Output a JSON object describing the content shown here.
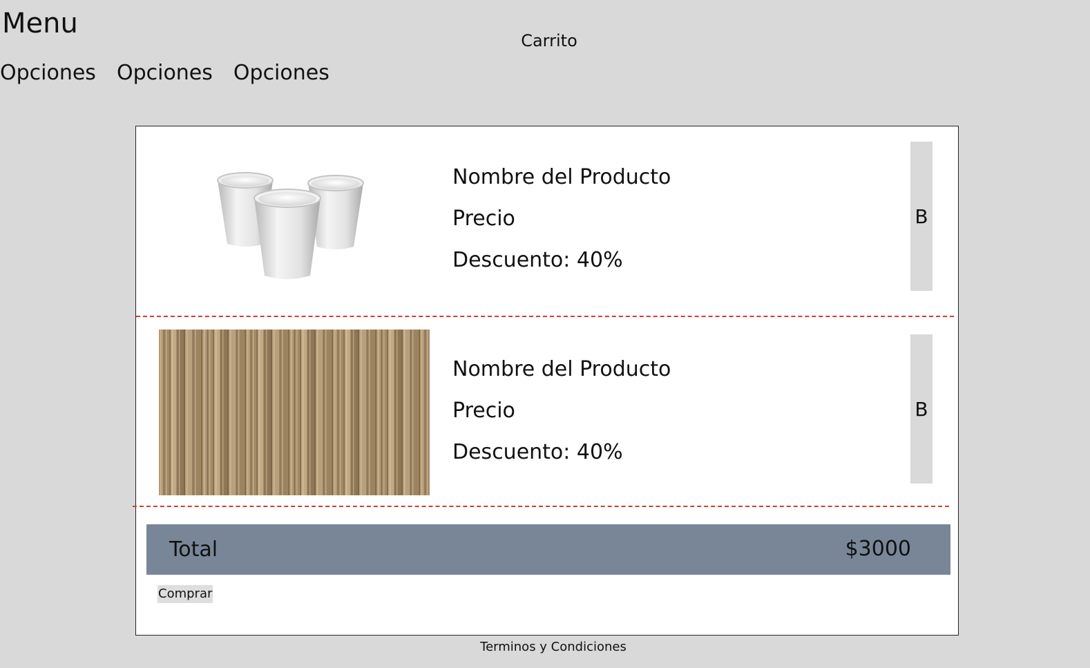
{
  "header": {
    "menu_title": "Menu",
    "page_title": "Carrito",
    "nav_items": [
      {
        "label": "Opciones"
      },
      {
        "label": "Opciones"
      },
      {
        "label": "Opciones"
      }
    ]
  },
  "cart": {
    "items": [
      {
        "image": "paper-cups",
        "name": "Nombre del Producto",
        "price_label": "Precio",
        "discount": "Descuento: 40%",
        "action_label": "B"
      },
      {
        "image": "paper-straws",
        "name": "Nombre del Producto",
        "price_label": "Precio",
        "discount": "Descuento: 40%",
        "action_label": "B"
      }
    ],
    "total_label": "Total",
    "total_value": "$3000",
    "buy_label": "Comprar"
  },
  "footer": {
    "terms_label": "Terminos y Condiciones"
  },
  "colors": {
    "background": "#d9d9d9",
    "total_bar": "#788698",
    "divider": "#d63a2f"
  }
}
